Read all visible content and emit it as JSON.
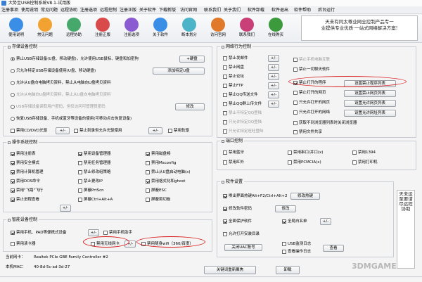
{
  "title": "大势至USB控制系统V8.1-试用版",
  "menu": [
    "注册事项",
    "使用说明",
    "常见问题",
    "远程协助",
    "注册选项",
    "远程控制",
    "注册正版",
    "关于软件",
    "下载新版",
    "访问官网",
    "联系我们",
    "关于我们",
    "软件卸载",
    "软件退出",
    "软件帮助",
    "后台运行"
  ],
  "toolbar": [
    {
      "label": "使用说明",
      "icon": "help-book-icon",
      "color": "#3a8ee6"
    },
    {
      "label": "常见问题",
      "icon": "question-icon",
      "color": "#f2a230"
    },
    {
      "label": "远程协助",
      "icon": "remote-help-icon",
      "color": "#46a86b"
    },
    {
      "label": "注册正版",
      "icon": "register-icon",
      "color": "#d94a4a"
    },
    {
      "label": "注册选项",
      "icon": "register-options-icon",
      "color": "#8b5bd1"
    },
    {
      "label": "关于软件",
      "icon": "about-icon",
      "color": "#3a8ee6"
    },
    {
      "label": "断本划分",
      "icon": "partition-icon",
      "color": "#4cb3c9"
    },
    {
      "label": "访问官网",
      "icon": "globe-icon",
      "color": "#e07a2a"
    },
    {
      "label": "联系我们",
      "icon": "contact-icon",
      "color": "#c93f78"
    },
    {
      "label": "在线购买",
      "icon": "shop-icon",
      "color": "#3c9a3c"
    }
  ],
  "banner": [
    "天未有同太尊业网全控制产品专一",
    "业提供专业优质·一站式网络解决方案!"
  ],
  "storage": {
    "title": "存储设备控制",
    "items": [
      "禁止USB存储设备(U盘、移动硬盘)，允许使用USB鼠标、键盘和加密狗",
      "只允许特定USB存储设备使用(U盘、移动硬盘)",
      "允许从U盘向电脑拷贝资料，禁止从电脑向U盘拷贝资料",
      "允许从电脑向U盘拷贝资料，禁止从U盘向电脑拷贝资料",
      "USB存储设备读取用户密码，但仅访问可管理员密码",
      "恢复USB存储设备、手机或蓝牙等设备的使用(可移动点击恢复设备)"
    ],
    "btn_disk": "+硬盘",
    "btn_add": "添加特定U盘",
    "btn_edit": "修改",
    "cd": "禁用CD/DVD光驱",
    "burn": "禁止刻录但允许光驱使用",
    "floppy": "禁用软驱",
    "plusminus": "+/-"
  },
  "os": {
    "title": "操作系统控制",
    "col1": [
      "禁用注册表",
      "禁用安全模式",
      "禁用计算机管理",
      "禁用DOS命令",
      "禁用\"飞路\"飞行",
      "禁止进程查看"
    ],
    "col2": [
      "禁用设备管理器",
      "禁用任务管理器",
      "禁止修改组策略",
      "禁止更改IP",
      "屏蔽PrtScn",
      "屏蔽Ctrl+Alt+A"
    ],
    "col3": [
      "禁用磁盘畅",
      "禁用Msconfig",
      "禁止从U盘启动电脑(x)",
      "禁用格式化和ghost",
      "屏蔽ESC",
      "屏蔽剪切板"
    ]
  },
  "smart": {
    "title": "智能设备控制",
    "phone_pad": "禁用手机、PAD等便携式设备",
    "phone_assist": "禁用手机助手",
    "card_reader": "禁用读卡器",
    "wifi_card": "禁用无线网卡",
    "portable_wifi": "禁用随身wifi（360/百度）"
  },
  "net": {
    "title": "网络行为控制",
    "left": [
      "禁止发邮件",
      "禁止网盘",
      "禁止论坛",
      "禁止FTP",
      "禁止QQ传送文件",
      "禁止QQ群上传文件",
      "禁止不特定QQ登陆",
      "只允许特定QQ登陆",
      "只允许特定旺旺登陆"
    ],
    "right": [
      "禁止手机电脑互联",
      "禁止一切聊天软件",
      "禁止打开的程序",
      "禁止打开的网页",
      "只允许打开的网页",
      "只允许打开的网络",
      "获取不到浏览器列表时关闭浏览器",
      "禁用文件共享"
    ],
    "btn_prog": "设置禁止程序列表",
    "btn_web": "设置禁止网页列表",
    "btn_allow": "设置允许网页列表",
    "btn_allow2": "设置允许网址列表"
  },
  "port": {
    "title": "端口控制",
    "items": [
      "禁用蓝牙",
      "禁用串口/并口(x)",
      "禁用1394",
      "禁用红外",
      "禁用PCMCIA(x)",
      "禁用打印机"
    ]
  },
  "settings": {
    "title": "软件设置",
    "hotkey": "唤出界面热键Alt+F2/Ctrl+Alt+2",
    "btn_hotkey": "修改热键",
    "pwd": "修改软件密码",
    "btn_edit": "修改",
    "tamper": "全面保护软件",
    "whitelist": "全局白名单",
    "deploy": "允许打开安装目录",
    "btn_uac": "关闭UAC账号",
    "log": "USB监测日志",
    "opfile": "查看操作日志",
    "btn_view": "查看"
  },
  "info": {
    "name_label": "当前网卡：",
    "name_value": "Realtek PCIe GBE Family Controller #2",
    "mac_label": "本机MAC：",
    "mac_value": "40-8d-5c-ad-3d-27"
  },
  "bottom": {
    "close_all": "关键词重新聚焦",
    "uninstall": "卸载"
  },
  "sidetext": "天未运至要请尽远程协助",
  "watermark": "3DMGAME"
}
